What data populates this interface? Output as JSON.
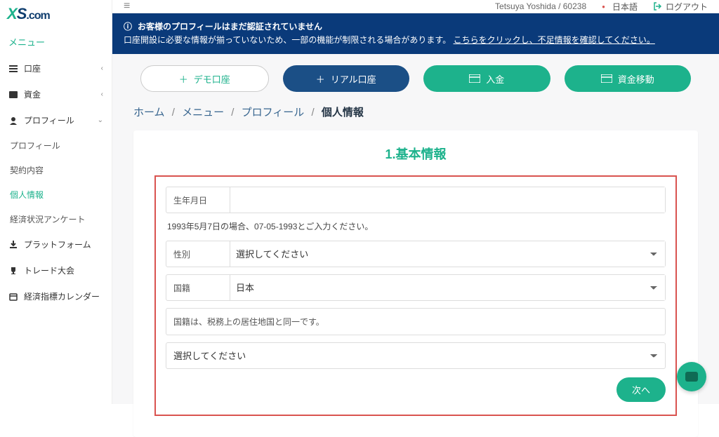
{
  "logo": {
    "x": "X",
    "s": "S",
    "com": ".com"
  },
  "topbar": {
    "user": "Tetsuya Yoshida / 60238",
    "lang": "日本語",
    "logout": "ログアウト"
  },
  "sidebar": {
    "menu_title": "メニュー",
    "items": [
      {
        "label": "口座",
        "icon": "list-icon",
        "chev": "‹"
      },
      {
        "label": "資金",
        "icon": "wallet-icon",
        "chev": "‹"
      },
      {
        "label": "プロフィール",
        "icon": "user-icon",
        "chev": "⌄"
      }
    ],
    "sub": [
      {
        "label": "プロフィール"
      },
      {
        "label": "契約内容"
      },
      {
        "label": "個人情報",
        "active": true
      },
      {
        "label": "経済状況アンケート"
      }
    ],
    "items2": [
      {
        "label": "プラットフォーム",
        "icon": "download-icon"
      },
      {
        "label": "トレード大会",
        "icon": "trophy-icon"
      },
      {
        "label": "経済指標カレンダー",
        "icon": "calendar-icon"
      }
    ]
  },
  "banner": {
    "title": "お客様のプロフィールはまだ認証されていません",
    "body_a": "口座開設に必要な情報が揃っていないため、一部の機能が制限される場合があります。",
    "link": "こちらをクリックし、不足情報を確認してください。"
  },
  "actions": {
    "demo": "デモ口座",
    "real": "リアル口座",
    "deposit": "入金",
    "transfer": "資金移動"
  },
  "breadcrumb": {
    "a": "ホーム",
    "b": "メニュー",
    "c": "プロフィール",
    "d": "個人情報",
    "sep": "/"
  },
  "form": {
    "title": "1.基本情報",
    "dob_label": "生年月日",
    "dob_hint": "1993年5月7日の場合、07-05-1993とご入力ください。",
    "gender_label": "性別",
    "gender_placeholder": "選択してください",
    "nat_label": "国籍",
    "nat_value": "日本",
    "tax_note": "国籍は、税務上の居住地国と同一です。",
    "tax_placeholder": "選択してください",
    "next": "次へ"
  }
}
